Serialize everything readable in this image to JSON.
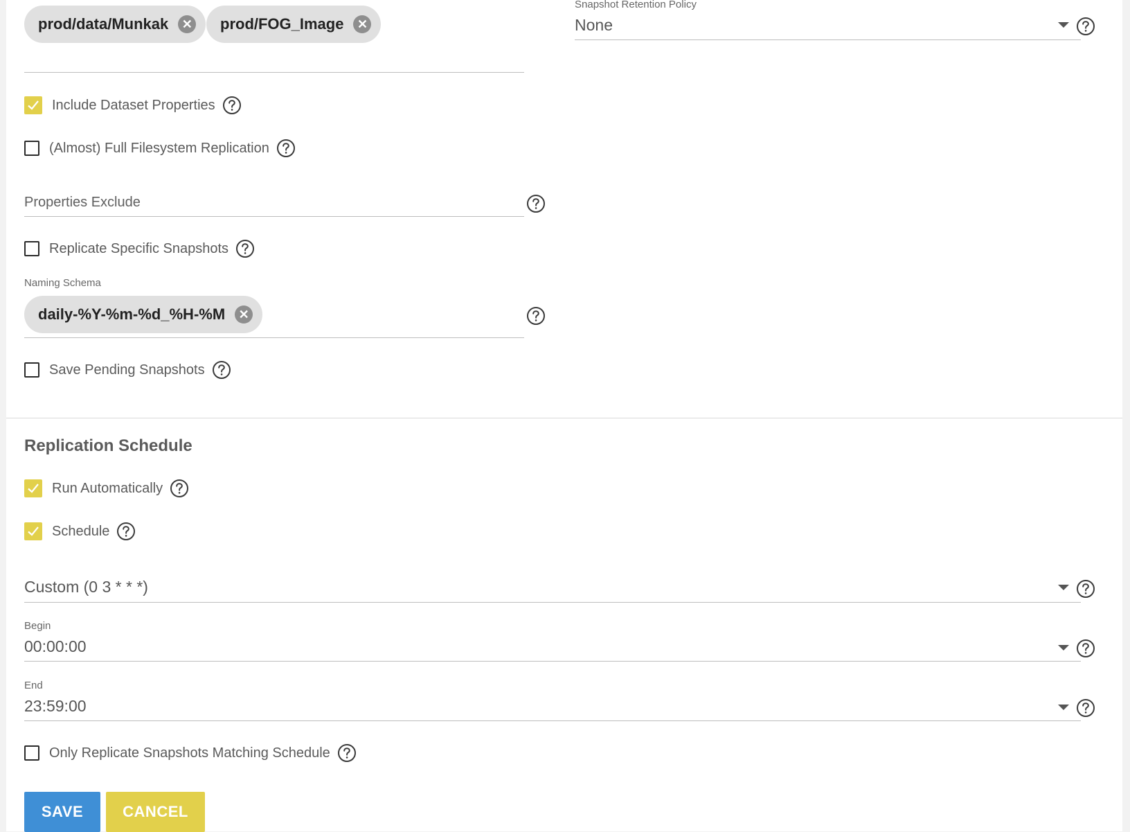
{
  "source_datasets": {
    "chips": [
      "prod/data/Munkak",
      "prod/FOG_Image"
    ],
    "remove_glyph": "✕"
  },
  "retention": {
    "label": "Snapshot Retention Policy",
    "value": "None"
  },
  "options": {
    "include_dataset_properties": {
      "label": "Include Dataset Properties",
      "checked": true
    },
    "full_filesystem_replication": {
      "label": "(Almost) Full Filesystem Replication",
      "checked": false
    },
    "properties_exclude_placeholder": "Properties Exclude",
    "replicate_specific_snapshots": {
      "label": "Replicate Specific Snapshots",
      "checked": false
    },
    "naming_schema": {
      "label": "Naming Schema",
      "chip": "daily-%Y-%m-%d_%H-%M"
    },
    "save_pending_snapshots": {
      "label": "Save Pending Snapshots",
      "checked": false
    }
  },
  "schedule_section": {
    "title": "Replication Schedule",
    "run_automatically": {
      "label": "Run Automatically",
      "checked": true
    },
    "schedule": {
      "label": "Schedule",
      "checked": true
    },
    "preset_value": "Custom (0 3 * * *)",
    "begin": {
      "label": "Begin",
      "value": "00:00:00"
    },
    "end": {
      "label": "End",
      "value": "23:59:00"
    },
    "only_matching": {
      "label": "Only Replicate Snapshots Matching Schedule",
      "checked": false
    }
  },
  "actions": {
    "save_label": "SAVE",
    "cancel_label": "CANCEL"
  },
  "colors": {
    "checkbox_checked": "#e2d04b",
    "save_button": "#3f8fd6",
    "cancel_button": "#e2d04b",
    "chip_bg": "#e0e0e0"
  },
  "icons": {
    "help": "help-circle-icon",
    "check": "check-icon",
    "remove": "close-circle-icon",
    "dropdown": "caret-down-icon"
  }
}
